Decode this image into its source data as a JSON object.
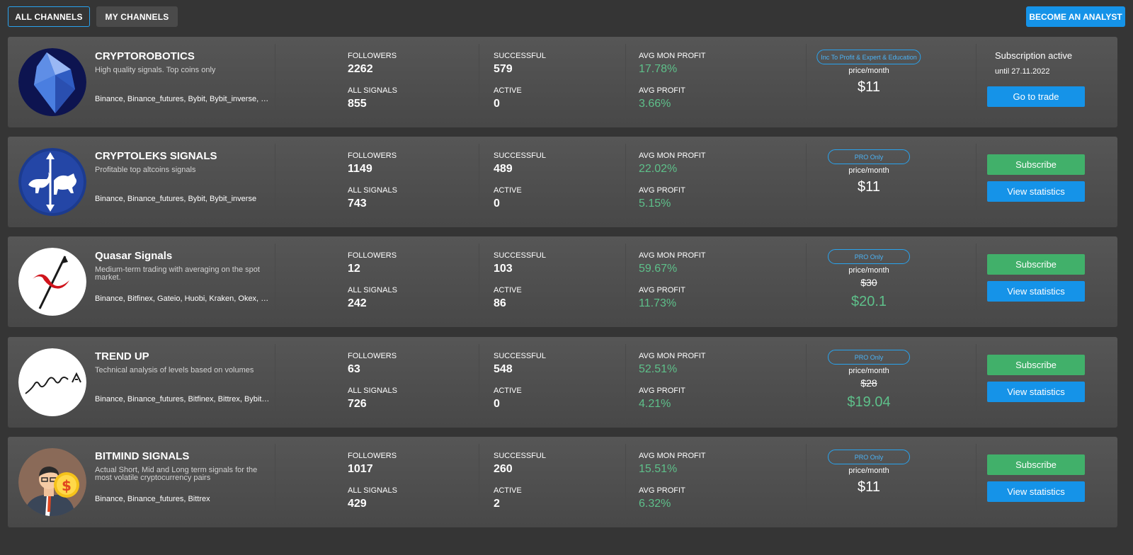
{
  "tabs": {
    "all_channels": "ALL CHANNELS",
    "my_channels": "MY CHANNELS"
  },
  "become_analyst": "BECOME AN ANALYST",
  "labels": {
    "followers": "FOLLOWERS",
    "all_signals": "ALL SIGNALS",
    "successful": "SUCCESSFUL",
    "active": "ACTIVE",
    "avg_mon_profit": "AVG MON PROFIT",
    "avg_profit": "AVG PROFIT",
    "price_month": "price/month"
  },
  "colors": {
    "accent_blue": "#1593e8",
    "green": "#41b06a",
    "profit_green": "#5ec08a"
  },
  "channels": [
    {
      "name": "CRYPTOROBOTICS",
      "description": "High quality signals. Top coins only",
      "exchanges": "Binance, Binance_futures, Bybit, Bybit_inverse, Bitfinex",
      "avatar_icon": "crystal-icon",
      "followers": "2262",
      "all_signals": "855",
      "successful": "579",
      "active": "0",
      "avg_mon_profit": "17.78%",
      "avg_profit": "3.66%",
      "badge": "Inc To Profit & Expert & Education",
      "price": "$11",
      "subscription_active": "Subscription active",
      "subscription_until": "until 27.11.2022",
      "primary_action": "Go to trade"
    },
    {
      "name": "CRYPTOLEKS SIGNALS",
      "description": "Profitable top altcoins signals",
      "exchanges": "Binance, Binance_futures, Bybit, Bybit_inverse",
      "avatar_icon": "bull-bear-icon",
      "followers": "1149",
      "all_signals": "743",
      "successful": "489",
      "active": "0",
      "avg_mon_profit": "22.02%",
      "avg_profit": "5.15%",
      "badge": "PRO Only",
      "price": "$11",
      "subscribe": "Subscribe",
      "view_stats": "View statistics"
    },
    {
      "name": "Quasar Signals",
      "description": "Medium-term trading with averaging on the spot market.",
      "exchanges": "Binance, Bitfinex, Gateio, Huobi, Kraken, Okex, Poloniex",
      "avatar_icon": "quasar-icon",
      "followers": "12",
      "all_signals": "242",
      "successful": "103",
      "active": "86",
      "avg_mon_profit": "59.67%",
      "avg_profit": "11.73%",
      "badge": "PRO Only",
      "old_price": "$30",
      "price": "$20.1",
      "subscribe": "Subscribe",
      "view_stats": "View statistics"
    },
    {
      "name": "TREND UP",
      "description": "Technical analysis of levels based on volumes",
      "exchanges": "Binance, Binance_futures, Bitfinex, Bittrex, Bybit, Bybit_inverse",
      "avatar_icon": "trend-line-icon",
      "followers": "63",
      "all_signals": "726",
      "successful": "548",
      "active": "0",
      "avg_mon_profit": "52.51%",
      "avg_profit": "4.21%",
      "badge": "PRO Only",
      "old_price": "$28",
      "price": "$19.04",
      "subscribe": "Subscribe",
      "view_stats": "View statistics"
    },
    {
      "name": "BITMIND SIGNALS",
      "description": "Actual Short, Mid and Long term signals for the most volatile cryptocurrency pairs",
      "exchanges": "Binance, Binance_futures, Bittrex",
      "avatar_icon": "businessman-coin-icon",
      "followers": "1017",
      "all_signals": "429",
      "successful": "260",
      "active": "2",
      "avg_mon_profit": "15.51%",
      "avg_profit": "6.32%",
      "badge": "PRO Only",
      "price": "$11",
      "subscribe": "Subscribe",
      "view_stats": "View statistics"
    }
  ]
}
